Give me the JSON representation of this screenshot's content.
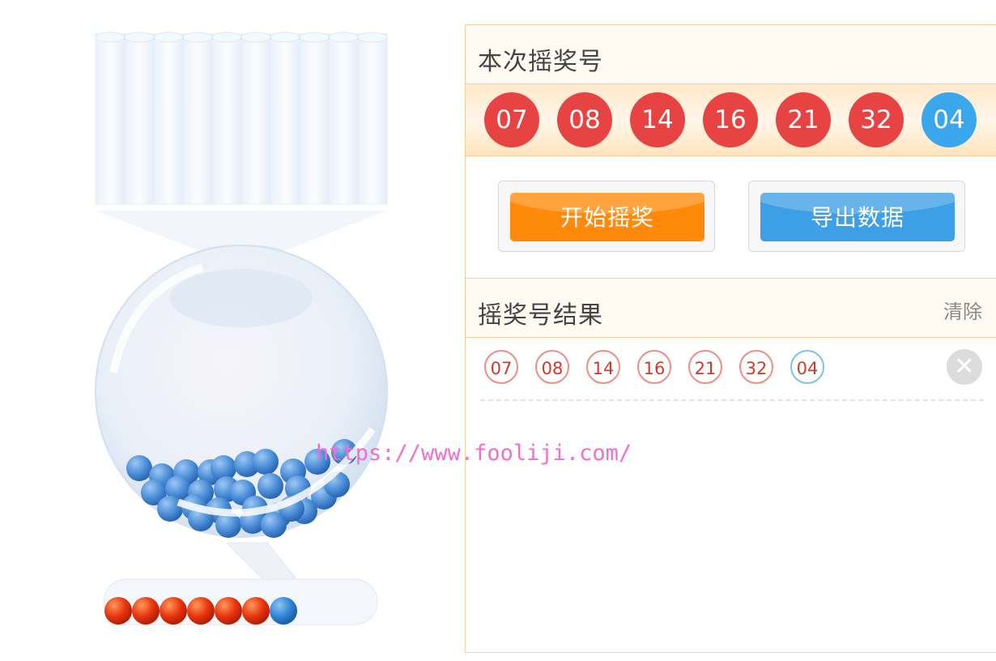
{
  "current_draw": {
    "title": "本次摇奖号",
    "balls": [
      {
        "number": "07",
        "color": "red"
      },
      {
        "number": "08",
        "color": "red"
      },
      {
        "number": "14",
        "color": "red"
      },
      {
        "number": "16",
        "color": "red"
      },
      {
        "number": "21",
        "color": "red"
      },
      {
        "number": "32",
        "color": "red"
      },
      {
        "number": "04",
        "color": "blue"
      }
    ]
  },
  "actions": {
    "start_label": "开始摇奖",
    "export_label": "导出数据"
  },
  "results": {
    "title": "摇奖号结果",
    "clear_label": "清除",
    "rows": [
      {
        "balls": [
          {
            "number": "07",
            "color": "red"
          },
          {
            "number": "08",
            "color": "red"
          },
          {
            "number": "14",
            "color": "red"
          },
          {
            "number": "16",
            "color": "red"
          },
          {
            "number": "21",
            "color": "red"
          },
          {
            "number": "32",
            "color": "red"
          },
          {
            "number": "04",
            "color": "blue"
          }
        ],
        "remove_icon": "close-icon"
      }
    ]
  },
  "machine": {
    "output_balls": [
      "red",
      "red",
      "red",
      "red",
      "red",
      "red",
      "blue"
    ]
  },
  "watermark": "https://www.fooliji.com/",
  "colors": {
    "red_ball": "#e84343",
    "blue_ball": "#3aa6ec",
    "start_button": "#ff8a0a",
    "export_button": "#3d9fe6",
    "panel_border": "#f4d39a"
  }
}
